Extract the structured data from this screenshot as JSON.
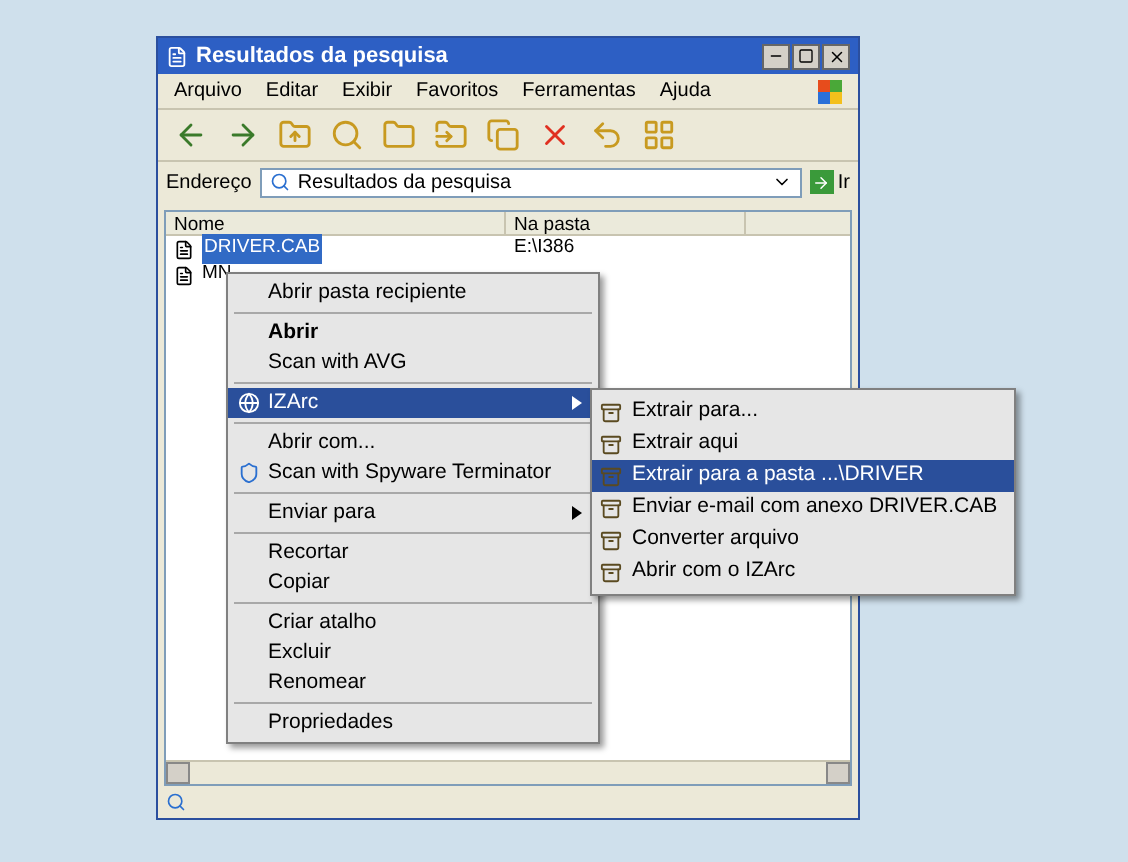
{
  "window": {
    "title": "Resultados da pesquisa"
  },
  "menu_bar": [
    "Arquivo",
    "Editar",
    "Exibir",
    "Favoritos",
    "Ferramentas",
    "Ajuda"
  ],
  "address": {
    "label": "Endereço",
    "value": "Resultados da pesquisa",
    "go": "Ir"
  },
  "columns": [
    "Nome",
    "Na pasta"
  ],
  "rows": [
    {
      "name": "DRIVER.CAB",
      "folder": "E:\\I386",
      "selected": true
    },
    {
      "name": "MN",
      "folder": "",
      "selected": false
    }
  ],
  "context_menu": [
    {
      "kind": "item",
      "label": "Abrir pasta recipiente",
      "bold": false,
      "selected": false
    },
    {
      "kind": "separator"
    },
    {
      "kind": "item",
      "label": "Abrir",
      "bold": true,
      "selected": false
    },
    {
      "kind": "item",
      "label": "Scan with AVG",
      "bold": false,
      "selected": false
    },
    {
      "kind": "separator"
    },
    {
      "kind": "submenu",
      "label": "IZArc",
      "icon": true,
      "selected": true
    },
    {
      "kind": "separator"
    },
    {
      "kind": "item",
      "label": "Abrir com...",
      "bold": false,
      "selected": false
    },
    {
      "kind": "icon_item",
      "label": "Scan with Spyware Terminator",
      "selected": false
    },
    {
      "kind": "separator"
    },
    {
      "kind": "submenu",
      "label": "Enviar para",
      "icon": false,
      "selected": false
    },
    {
      "kind": "separator"
    },
    {
      "kind": "item",
      "label": "Recortar",
      "bold": false,
      "selected": false
    },
    {
      "kind": "item",
      "label": "Copiar",
      "bold": false,
      "selected": false
    },
    {
      "kind": "separator"
    },
    {
      "kind": "item",
      "label": "Criar atalho",
      "bold": false,
      "selected": false
    },
    {
      "kind": "item",
      "label": "Excluir",
      "bold": false,
      "selected": false
    },
    {
      "kind": "item",
      "label": "Renomear",
      "bold": false,
      "selected": false
    },
    {
      "kind": "separator"
    },
    {
      "kind": "item",
      "label": "Propriedades",
      "bold": false,
      "selected": false
    }
  ],
  "submenu": [
    {
      "label": "Extrair para...",
      "selected": false
    },
    {
      "label": "Extrair aqui",
      "selected": false
    },
    {
      "label": "Extrair para a pasta ...\\DRIVER",
      "selected": true
    },
    {
      "label": "Enviar e-mail com anexo DRIVER.CAB",
      "selected": false
    },
    {
      "label": "Converter arquivo",
      "selected": false
    },
    {
      "label": "Abrir com o IZArc",
      "selected": false
    }
  ]
}
